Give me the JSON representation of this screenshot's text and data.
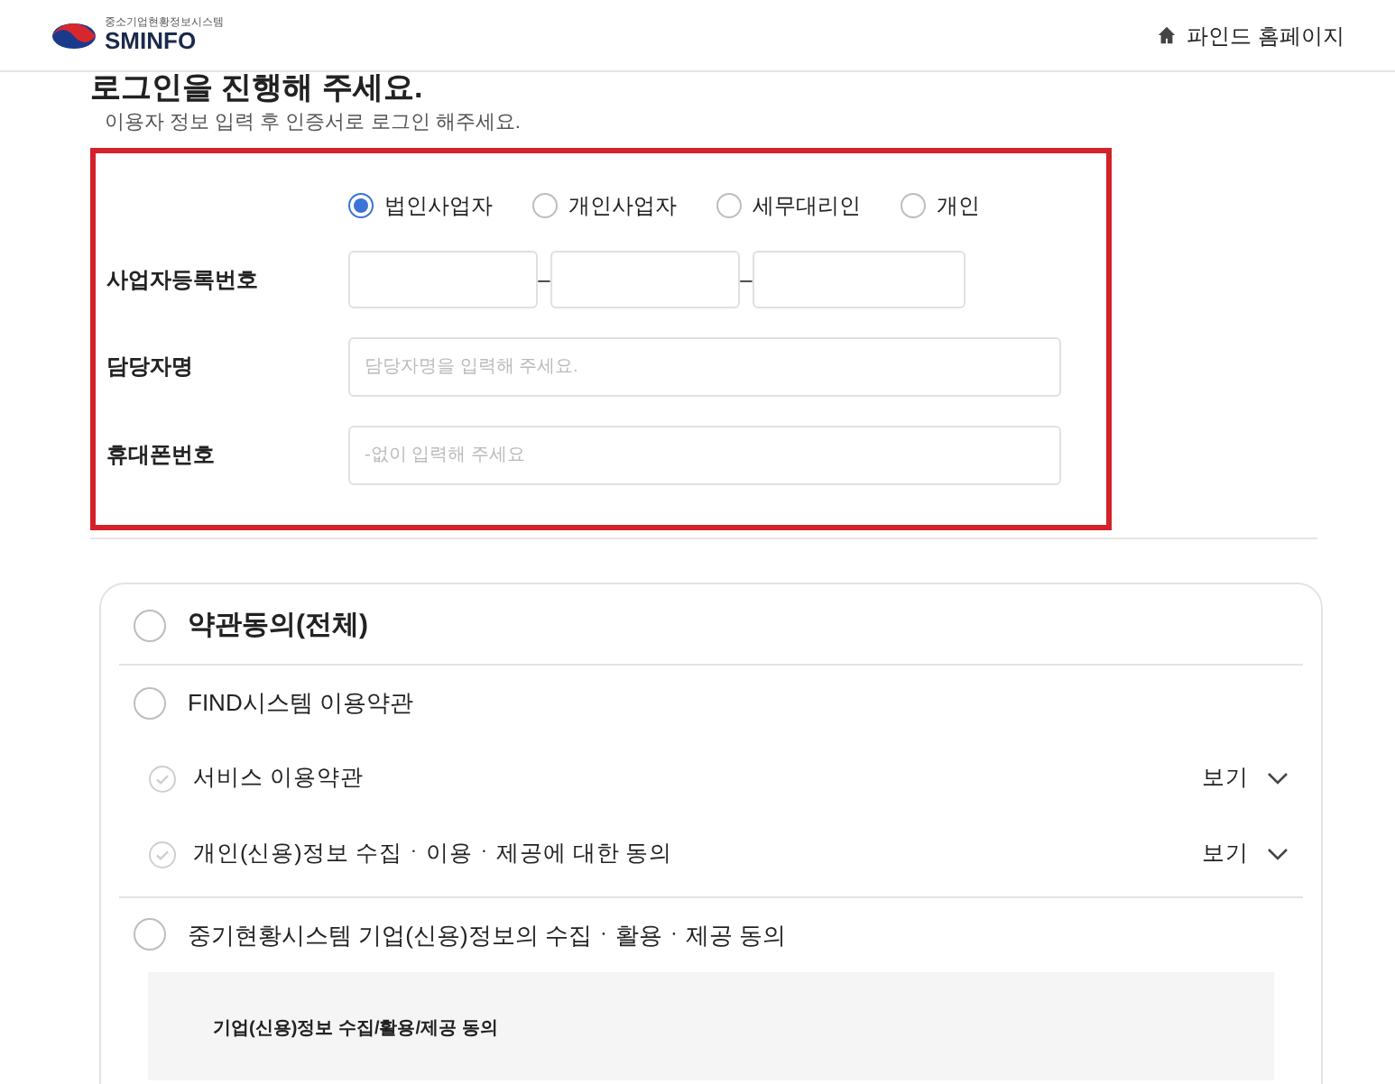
{
  "header": {
    "logo_caption": "중소기업현황정보시스템",
    "logo_text": "SMINFO",
    "home_link": "파인드 홈페이지"
  },
  "title": "로그인을 진행해 주세요.",
  "subtitle": "이용자 정보 입력 후 인증서로 로그인 해주세요.",
  "user_types": [
    {
      "label": "법인사업자",
      "selected": true
    },
    {
      "label": "개인사업자",
      "selected": false
    },
    {
      "label": "세무대리인",
      "selected": false
    },
    {
      "label": "개인",
      "selected": false
    }
  ],
  "fields": [
    {
      "kind": "split",
      "label": "사업자등록번호",
      "separators": [
        "–",
        "–"
      ]
    },
    {
      "kind": "text",
      "label": "담당자명",
      "placeholder": "담당자명을 입력해 주세요."
    },
    {
      "kind": "text",
      "label": "휴대폰번호",
      "placeholder": "-없이 입력해 주세요"
    }
  ],
  "terms": {
    "all_label": "약관동의(전체)",
    "all_checked": false,
    "groups": [
      {
        "label": "FIND시스템 이용약관",
        "checked": false,
        "children": [
          {
            "label": "서비스 이용약관",
            "checked": false,
            "view": "보기"
          },
          {
            "label": "개인(신용)정보 수집ㆍ이용ㆍ제공에 대한 동의",
            "checked": false,
            "view": "보기"
          }
        ]
      },
      {
        "label": "중기현황시스템 기업(신용)정보의 수집ㆍ활용ㆍ제공 동의",
        "checked": false,
        "detail_title": "기업(신용)정보 수집/활용/제공 동의"
      }
    ]
  }
}
